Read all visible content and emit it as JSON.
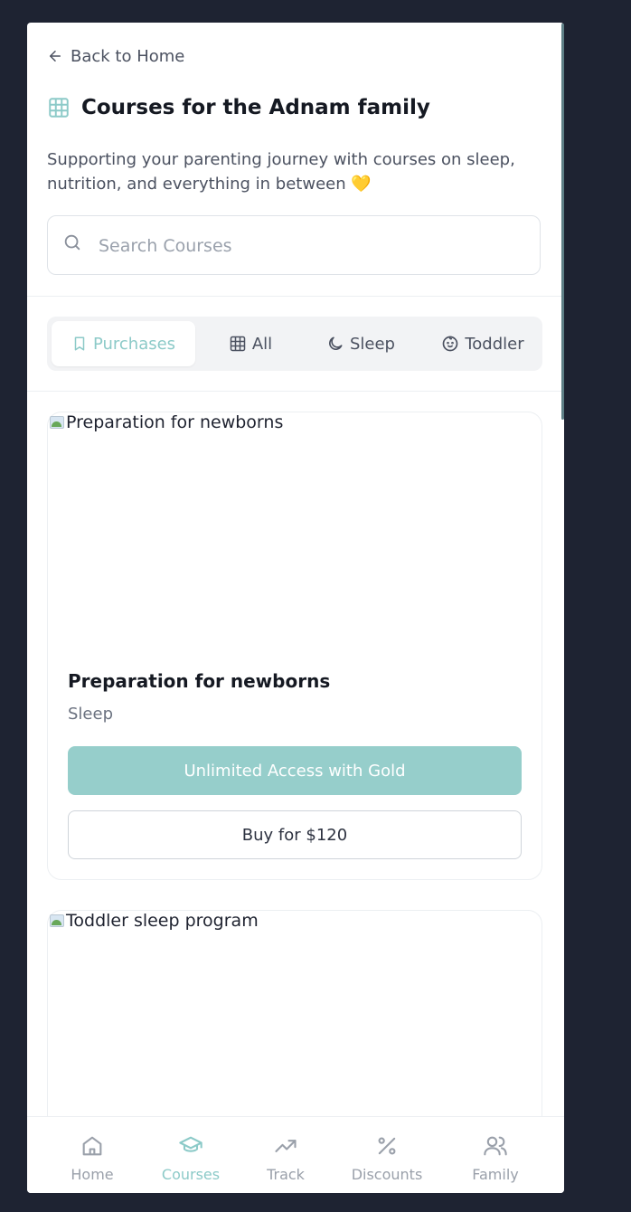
{
  "header": {
    "back_label": "Back to Home",
    "title": "Courses for the Adnam family",
    "subtitle": "Supporting your parenting journey with courses on sleep, nutrition, and everything in between 💛"
  },
  "search": {
    "placeholder": "Search Courses",
    "value": ""
  },
  "tabs": [
    {
      "label": "Purchases",
      "icon": "bookmark-icon",
      "active": true
    },
    {
      "label": "All",
      "icon": "grid-icon",
      "active": false
    },
    {
      "label": "Sleep",
      "icon": "moon-icon",
      "active": false
    },
    {
      "label": "Toddler",
      "icon": "baby-icon",
      "active": false
    }
  ],
  "courses": [
    {
      "image_alt": "Preparation for newborns",
      "title": "Preparation for newborns",
      "category": "Sleep",
      "gold_label": "Unlimited Access with Gold",
      "buy_label": "Buy for $120"
    },
    {
      "image_alt": "Toddler sleep program"
    }
  ],
  "bottom_nav": [
    {
      "label": "Home",
      "icon": "home-icon",
      "active": false
    },
    {
      "label": "Courses",
      "icon": "graduation-cap-icon",
      "active": true
    },
    {
      "label": "Track",
      "icon": "trending-up-icon",
      "active": false
    },
    {
      "label": "Discounts",
      "icon": "percent-icon",
      "active": false
    },
    {
      "label": "Family",
      "icon": "users-icon",
      "active": false
    }
  ],
  "colors": {
    "accent": "#8ccac8",
    "gold_button": "#96cecb",
    "page_background": "#1e2332"
  }
}
